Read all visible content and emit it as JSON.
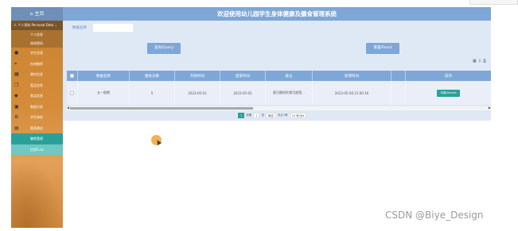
{
  "header": {
    "title": "欢迎使用幼儿园学生身体健康及膳食管理系统"
  },
  "sidebar": {
    "home": "⌂ 主页",
    "user_menu": "人 个人资料 Personal Data ⌄",
    "sub_items": [
      "个人信息",
      "修改密码"
    ],
    "items": [
      {
        "label": "学生信息",
        "icon": "user-icon"
      },
      {
        "label": "在线教师",
        "icon": "person-icon"
      },
      {
        "label": "餐饮信息",
        "icon": "grid-icon"
      },
      {
        "label": "菜品信息",
        "icon": "copy-icon"
      },
      {
        "label": "食品信息",
        "icon": "tag-icon"
      },
      {
        "label": "数据分析",
        "icon": "chart-icon"
      },
      {
        "label": "学生体检",
        "icon": "settings-icon"
      },
      {
        "label": "营养建议",
        "icon": "save-icon"
      }
    ],
    "active_item": "膳食管理",
    "active_sub": "信息Func"
  },
  "search": {
    "label": "数据名称",
    "value": "",
    "placeholder": ""
  },
  "buttons": {
    "query": "查询/Query",
    "reset": "重置/Reset"
  },
  "table": {
    "columns": [
      "",
      "数据名称",
      "膳食天数",
      "开始时间",
      "结束时间",
      "备注",
      "新增时间",
      "",
      "操作"
    ],
    "rows": [
      {
        "cells": [
          "",
          "五一假期",
          "5",
          "2023-05-01",
          "2023-05-05",
          "假日期间饮食可放宽...",
          "2023-05-06 21:00:16",
          ""
        ],
        "action": "详情/Details"
      }
    ]
  },
  "pager": {
    "current": "1",
    "goto_label": "到第",
    "page_input": "1",
    "page_unit": "页",
    "confirm": "确定",
    "total": "共计1条",
    "per_page": "10 条/页"
  },
  "watermark": "CSDN @Biye_Design"
}
